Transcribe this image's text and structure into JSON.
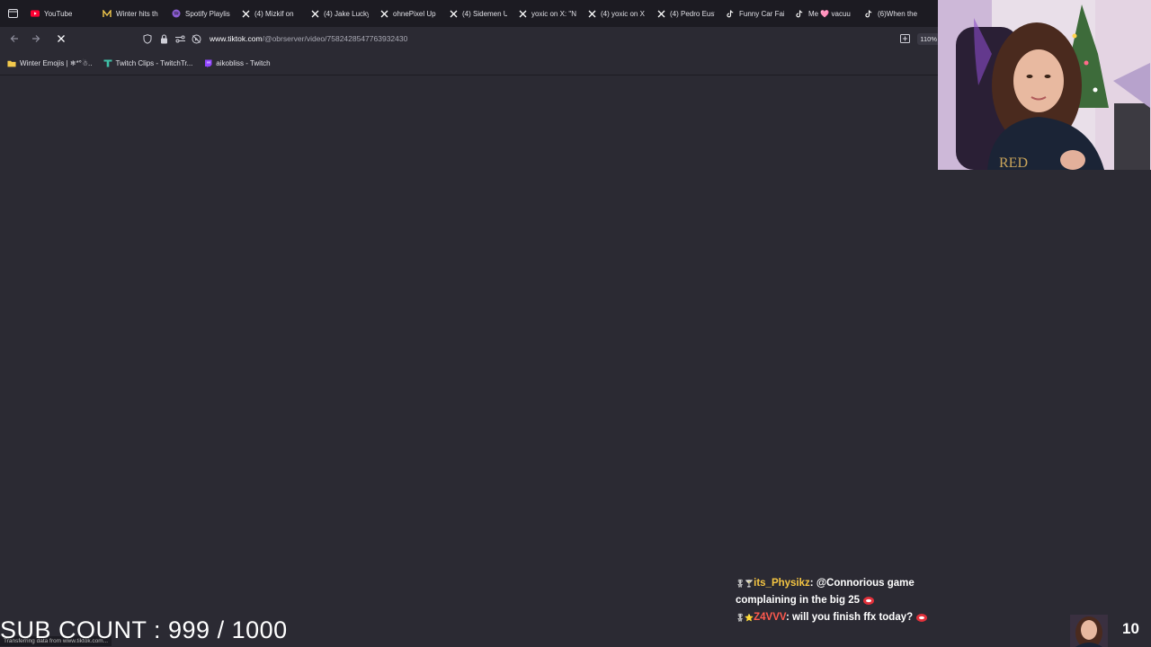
{
  "browser": {
    "tabs": [
      {
        "label": "YouTube",
        "icon": "youtube-icon",
        "color": "#ff0033"
      },
      {
        "label": "Winter hits th",
        "icon": "bookmark-m-icon",
        "color": "#f2c94c"
      },
      {
        "label": "Spotify Playlis",
        "icon": "spotify-icon",
        "color": "#8a5cd1"
      },
      {
        "label": "(4) Mizkif on",
        "icon": "x-icon",
        "color": "#ffffff"
      },
      {
        "label": "(4) Jake Lucky",
        "icon": "x-icon",
        "color": "#ffffff"
      },
      {
        "label": "ohnePixel Up",
        "icon": "x-icon",
        "color": "#ffffff"
      },
      {
        "label": "(4) Sidemen U",
        "icon": "x-icon",
        "color": "#ffffff"
      },
      {
        "label": "yoxic on X: \"N",
        "icon": "x-icon",
        "color": "#ffffff"
      },
      {
        "label": "(4) yoxic on X",
        "icon": "x-icon",
        "color": "#ffffff"
      },
      {
        "label": "(4) Pedro Eust",
        "icon": "x-icon",
        "color": "#ffffff"
      },
      {
        "label": "Funny Car Fai",
        "icon": "tiktok-icon",
        "color": "#ffffff"
      },
      {
        "label": "Me 🩷 vacuu",
        "icon": "tiktok-icon",
        "color": "#ffffff"
      },
      {
        "label": "(6)When the",
        "icon": "tiktok-icon",
        "color": "#ffffff"
      }
    ],
    "url": {
      "host": "www.tiktok.com",
      "path": "/@obrserver/video/7582428547763932430"
    },
    "zoom": "110%",
    "bookmarks": [
      {
        "label": "Winter Emojis | ❄*°☃..",
        "icon": "folder-icon",
        "color": "#f2c94c"
      },
      {
        "label": "Twitch Clips - TwitchTr...",
        "icon": "twitchtracker-icon",
        "color": "#3fc1a8"
      },
      {
        "label": "aikobliss - Twitch",
        "icon": "twitch-icon",
        "color": "#9146ff"
      }
    ],
    "status_text": "Transferring data from www.tiktok.com..."
  },
  "overlay": {
    "sub_count": "SUB COUNT : 999 / 1000",
    "viewer_count": "10",
    "chat": [
      {
        "badges": "🎖🍸",
        "user": "its_Physikz",
        "message": "@Connorious game complaining in the big 25"
      },
      {
        "badges": "🎖⭐",
        "user": "Z4VVV",
        "message": "will you finish ffx today?"
      }
    ]
  }
}
